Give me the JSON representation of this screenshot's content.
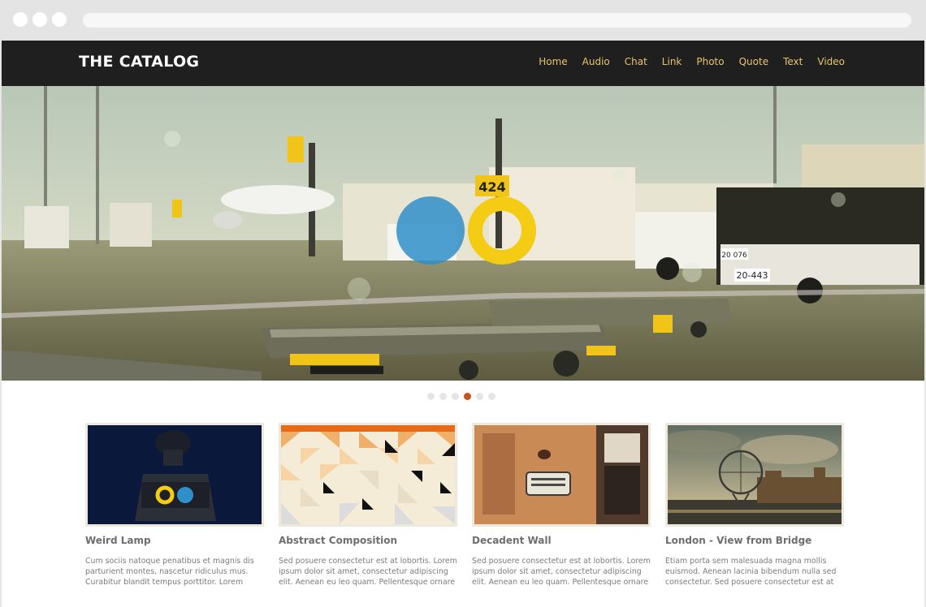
{
  "site": {
    "title": "THE CATALOG"
  },
  "nav": [
    "Home",
    "Audio",
    "Chat",
    "Link",
    "Photo",
    "Quote",
    "Text",
    "Video"
  ],
  "hero": {
    "slides": 6,
    "active_index": 3,
    "accent_blue": "#2f8fc9",
    "accent_yellow": "#f5cc14"
  },
  "cards": [
    {
      "title": "Weird Lamp",
      "text": "Cum sociis natoque penatibus et magnis dis parturient montes, nascetur ridiculus mus. Curabitur blandit tempus porttitor. Lorem ipsum dolor sit"
    },
    {
      "title": "Abstract Composition",
      "text": "Sed posuere consectetur est at lobortis. Lorem ipsum dolor sit amet, consectetur adipiscing elit. Aenean eu leo quam. Pellentesque ornare sem"
    },
    {
      "title": "Decadent Wall",
      "text": "Sed posuere consectetur est at lobortis. Lorem ipsum dolor sit amet, consectetur adipiscing elit. Aenean eu leo quam. Pellentesque ornare sem"
    },
    {
      "title": "London - View from Bridge",
      "text": "Etiam porta sem malesuada magna mollis euismod. Aenean lacinia bibendum nulla sed consectetur. Sed posuere consectetur est at lobortis. Maecenas"
    }
  ],
  "colors": {
    "header_bg": "#1f1f1f",
    "nav_link": "#e9c46a",
    "pager_active": "#c7531a"
  }
}
